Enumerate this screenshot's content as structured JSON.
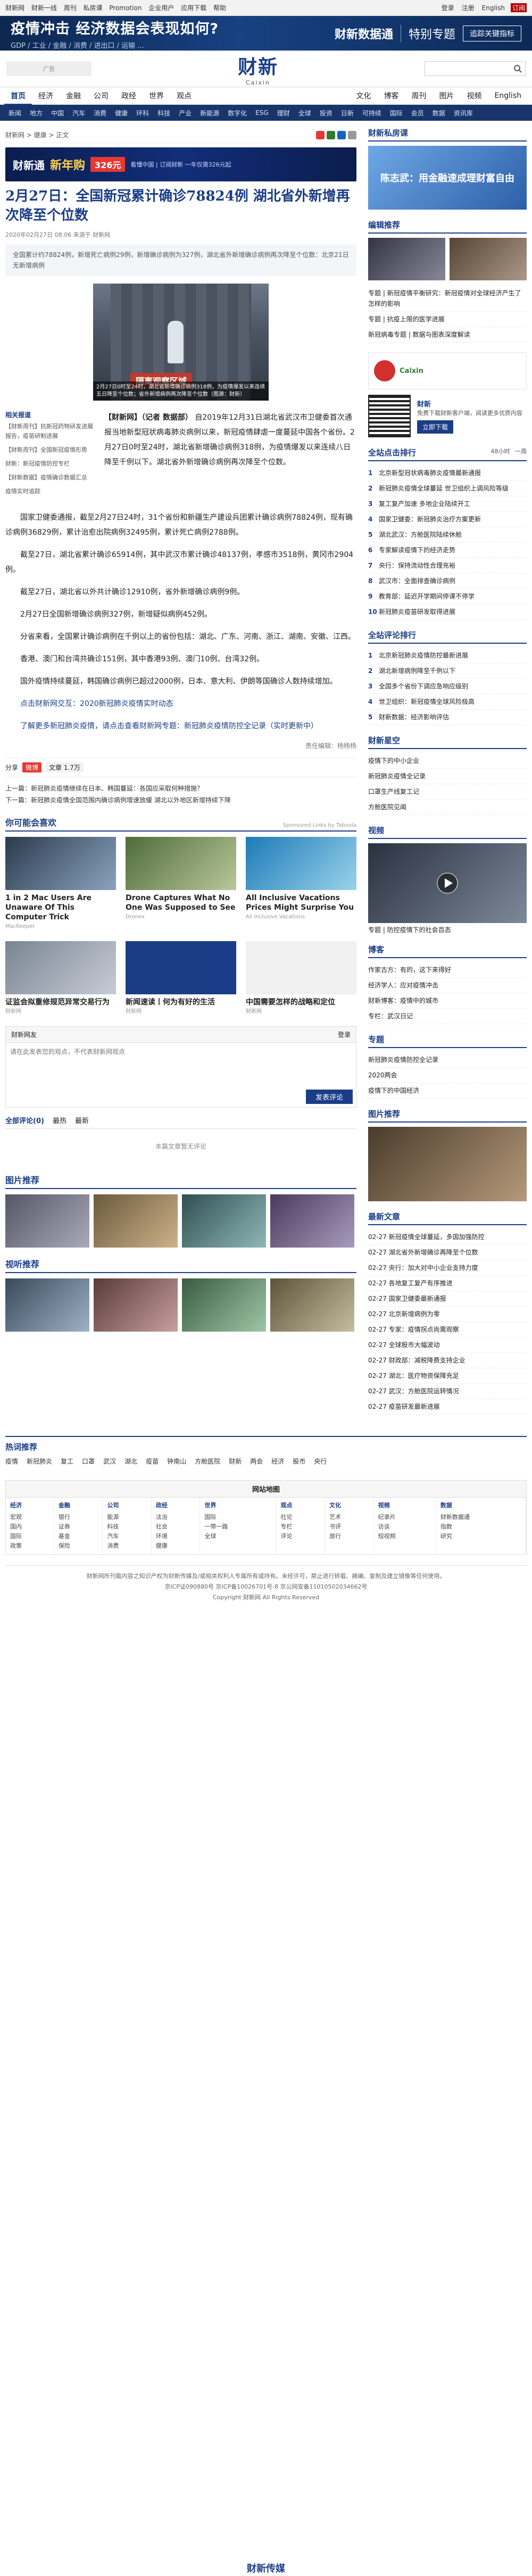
{
  "topbar": {
    "links": [
      "财新网",
      "财新一线",
      "周刊",
      "私房课",
      "Promotion",
      "企业用户",
      "应用下载",
      "帮助"
    ],
    "login": "登录",
    "register": "注册",
    "lang": "English",
    "subscribe": "订阅"
  },
  "banner": {
    "title": "疫情冲击 经济数据会表现如何?",
    "subtitle": "GDP / 工业 / 金融 / 消费 / 进出口 / 运输 ...",
    "logo": "财新数据通",
    "right": "特别专题",
    "button": "追踪关键指标"
  },
  "masthead": {
    "logo_cn": "财新",
    "logo_en": "Caixin",
    "ad": "广告"
  },
  "nav1": [
    "首页",
    "经济",
    "金融",
    "公司",
    "政经",
    "世界",
    "观点",
    "文化",
    "博客",
    "周刊",
    "图片",
    "视频",
    "English"
  ],
  "nav2": [
    "新闻",
    "地方",
    "中国",
    "汽车",
    "消费",
    "健康",
    "环科",
    "科技",
    "产业",
    "新能源",
    "数字化",
    "ESG",
    "理财",
    "全球",
    "投资",
    "日新",
    "可持续",
    "国际",
    "会员",
    "数据",
    "资讯库",
    "在线课堂",
    "全部"
  ],
  "crumb": "财新网 > 健康 > 正文",
  "adban": {
    "a1": "财新通",
    "a2": "新年购",
    "a3": "326元",
    "sub": "看懂中国 | 订阅财新 一年仅需326元起"
  },
  "article": {
    "title": "2月27日：全国新冠累计确诊78824例 湖北省外新增再次降至个位数",
    "meta": "2020年02月27日 08:06  来源于 财新网",
    "summary": "全国累计约78824例，新增死亡病例29例，新增确诊病例为327例，湖北省外新增确诊病例再次降至个位数：北京21日无新增病例",
    "photo_caption": "2月27日0时至24时，湖北省新增确诊病例318例，为疫情爆发以来连续五日降至个位数；省外新增病例再次降至个位数（图源：财新）",
    "photo_sign": "隔离观察区域",
    "left_head": "相关报道",
    "left_items": [
      "【财新周刊】抗新冠药物研发进展报告，疫苗研制进展",
      "【财新周刊】全国新冠疫情形势",
      "财新：新冠疫情防控专栏",
      "【财新数据】疫情确诊数据汇总",
      "疫情实时追踪"
    ],
    "lead_label": "【财新网】（记者 数据部）",
    "lead": "自2019年12月31日湖北省武汉市卫健委首次通报当地新型冠状病毒肺炎病例以来，新冠疫情肆虐一度蔓延中国各个省份。2月27日0时至24时，湖北省新增确诊病例318例，为疫情爆发以来连续八日降至千例以下。湖北省外新增确诊病例再次降至个位数。"
  },
  "body": [
    "国家卫健委通报，截至2月27日24时，31个省份和新疆生产建设兵团累计确诊病例78824例，现有确诊病例36829例，累计治愈出院病例32495例，累计死亡病例2788例。",
    "截至27日，湖北省累计确诊65914例，其中武汉市累计确诊48137例，孝感市3518例，黄冈市2904例。",
    "截至27日，湖北省以外共计确诊12910例，省外新增确诊病例9例。",
    "2月27日全国新增确诊病例327例，新增疑似病例452例。",
    "分省来看，全国累计确诊病例在千例以上的省份包括：湖北、广东、河南、浙江、湖南、安徽、江西。",
    "香港、澳门和台湾共确诊151例，其中香港93例、澳门10例、台湾32例。",
    "国外疫情持续蔓延，韩国确诊病例已超过2000例，日本、意大利、伊朗等国确诊人数持续增加。"
  ],
  "body_link": "点击财新网交互：2020新冠肺炎疫情实时动态",
  "body_link2": "了解更多新冠肺炎疫情，请点击查看财新网专题：新冠肺炎疫情防控全记录（实时更新中）",
  "editor": "责任编辑：杨杨杨",
  "share": {
    "label": "分享",
    "weibo": "微博",
    "count": "文章 1.7万"
  },
  "nextprev": {
    "prev": "上一篇：新冠肺炎疫情继续在日本、韩国蔓延：各国应采取何种措施？",
    "next": "下一篇：新冠肺炎疫情全国范围内确诊病例增速放缓 湖北以外地区新增持续下降"
  },
  "recommend": {
    "title": "你可能会喜欢",
    "sponsor": "Sponsored Links by Taboola",
    "cards": [
      {
        "t": "1 in 2 Mac Users Are Unaware Of This Computer Trick",
        "s": "MacKeeper"
      },
      {
        "t": "Drone Captures What No One Was Supposed to See",
        "s": "Dronex"
      },
      {
        "t": "All Inclusive Vacations Prices Might Surprise You",
        "s": "All Inclusive Vacations"
      },
      {
        "t": "证监会拟重修规范异常交易行为",
        "s": "财新网"
      },
      {
        "t": "新闻速读丨何为有好的生活",
        "s": "财新网"
      },
      {
        "t": "中国需要怎样的战略和定位",
        "s": "财新网"
      }
    ]
  },
  "comment": {
    "title": "财新网友",
    "login": "登录",
    "placeholder": "请在此发表您的观点，不代表财新网观点",
    "submit": "发表评论"
  },
  "comment_tabs": [
    "全部评论(0)",
    "最热",
    "最新"
  ],
  "empty": "本篇文章暂无评论",
  "photo_section": "图片推荐",
  "video_section": "视听推荐",
  "side": {
    "caixin_private": "财新私房课",
    "course_title": "陈志武：用金融速成理财富自由",
    "editor_picks": "编辑推荐",
    "editor_items": [
      "专题 | 新冠疫情平衡研究：新冠疫情对全球经济产生了怎样的影响",
      "专题 | 抗疫上限的医学进展",
      "新冠病毒专题 | 数据与图表深度解读"
    ],
    "app_title": "财新",
    "app_desc": "免费下载财新客户端，阅读更多优质内容",
    "app_btn": "立即下载",
    "hot_title": "全站点击排行",
    "hot_tabs": [
      "48小时",
      "一周"
    ],
    "hot_items": [
      "北京新型冠状病毒肺炎疫情最新通报",
      "新冠肺炎疫情全球蔓延 世卫组织上调风险等级",
      "复工复产加速 多地企业陆续开工",
      "国家卫健委：新冠肺炎治疗方案更新",
      "湖北武汉：方舱医院陆续休舱",
      "专家解读疫情下的经济走势",
      "央行：保持流动性合理充裕",
      "武汉市：全面排查确诊病例",
      "教育部：延迟开学期间停课不停学",
      "新冠肺炎疫苗研发取得进展"
    ],
    "hot_comment_title": "全站评论排行",
    "hot_comment_items": [
      "北京新冠肺炎疫情防控最新进展",
      "湖北新增病例降至千例以下",
      "全国多个省份下调应急响应级别",
      "世卫组织：新冠疫情全球风险极高",
      "财新数据：经济影响评估"
    ],
    "rec_title": "财新星空",
    "rec_items": [
      "疫情下的中小企业",
      "新冠肺炎疫情全记录",
      "口罩生产线复工记",
      "方舱医院见闻"
    ],
    "video_title": "视频",
    "video_caption": "专题 | 防控疫情下的社会百态",
    "blog_title": "博客",
    "blog_items": [
      "作家古方：有的，这下来得好",
      "经济学人：应对疫情冲击",
      "财新博客：疫情中的城市",
      "专栏：武汉日记"
    ],
    "zhuanti_title": "专题",
    "zhuanti_items": [
      "新冠肺炎疫情防控全记录",
      "2020两会",
      "疫情下的中国经济"
    ],
    "month_title": "图片推荐",
    "latest_title": "最新文章",
    "latest_items": [
      "02-27 新冠疫情全球蔓延，多国加强防控",
      "02-27 湖北省外新增确诊再降至个位数",
      "02-27 央行：加大对中小企业支持力度",
      "02-27 各地复工复产有序推进",
      "02-27 国家卫健委最新通报",
      "02-27 北京新增病例为零",
      "02-27 专家：疫情拐点尚需观察",
      "02-27 全球股市大幅波动",
      "02-27 财政部：减税降费支持企业",
      "02-27 湖北：医疗物资保障充足",
      "02-27 武汉：方舱医院运转情况",
      "02-27 疫苗研发最新进展"
    ]
  },
  "hotnews": {
    "title": "热词推荐",
    "items": [
      "疫情",
      "新冠肺炎",
      "复工",
      "口罩",
      "武汉",
      "湖北",
      "疫苗",
      "钟南山",
      "方舱医院",
      "财新",
      "两会",
      "经济",
      "股市",
      "央行"
    ]
  },
  "sitemap": {
    "title": "网站地图",
    "cols": [
      {
        "h": "经济",
        "i": [
          "宏观",
          "国内",
          "国际",
          "政策"
        ]
      },
      {
        "h": "金融",
        "i": [
          "银行",
          "证券",
          "基金",
          "保险"
        ]
      },
      {
        "h": "公司",
        "i": [
          "能源",
          "科技",
          "汽车",
          "消费"
        ]
      },
      {
        "h": "政经",
        "i": [
          "法治",
          "社会",
          "环境",
          "健康"
        ]
      },
      {
        "h": "世界",
        "i": [
          "国际",
          "一带一路",
          "全球"
        ]
      },
      {
        "h": "观点",
        "i": [
          "社论",
          "专栏",
          "评论"
        ]
      },
      {
        "h": "文化",
        "i": [
          "艺术",
          "书评",
          "旅行"
        ]
      },
      {
        "h": "视频",
        "i": [
          "纪录片",
          "访谈",
          "短视频"
        ]
      },
      {
        "h": "数据",
        "i": [
          "财新数据通",
          "指数",
          "研究"
        ]
      }
    ]
  },
  "footer": {
    "line1": "财新网所刊载内容之知识产权为财新传媒及/或相关权利人专属所有或持有。未经许可，禁止进行转载、摘编、复制及建立镜像等任何使用。",
    "line2": "京ICP证090880号  京ICP备10026701号-8  京公网安备11010502034662号",
    "line3": "Copyright 财新网 All Rights Reserved"
  },
  "bottom_logo": "财新传媒"
}
